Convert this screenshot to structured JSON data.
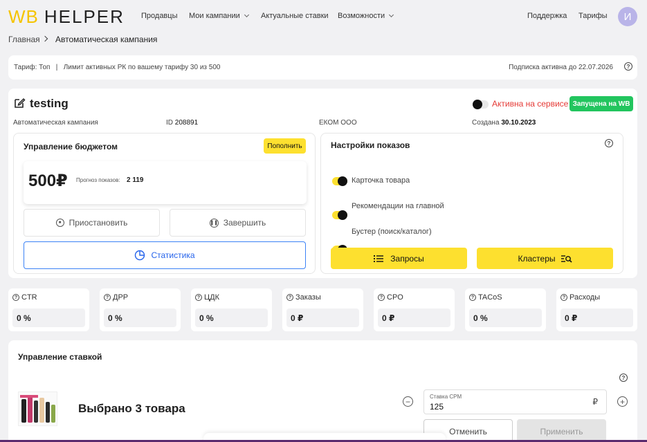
{
  "header": {
    "logo_wb": "WB",
    "logo_helper": "HELPER",
    "nav": [
      "Продавцы",
      "Мои кампании",
      "Актуальные ставки",
      "Возможности"
    ],
    "support": "Поддержка",
    "tariffs": "Тарифы",
    "avatar_letter": "И"
  },
  "breadcrumb": {
    "home": "Главная",
    "current": "Автоматическая кампания"
  },
  "tariff_bar": {
    "left": "Тариф: Топ   |   Лимит активных РК по вашему тарифу 30 из 500",
    "right": "Подписка активна до 22.07.2026"
  },
  "campaign": {
    "name": "testing",
    "active_label": "Активна на сервисе",
    "status_badge": "Запущена на WB",
    "type": "Автоматическая кампания",
    "id_label": "ID",
    "id_value": "208891",
    "company": "ЕКОМ ООО",
    "created_label": "Создана",
    "created_value": "30.10.2023"
  },
  "budget": {
    "title": "Управление бюджетом",
    "topup": "Пополнить",
    "amount": "500₽",
    "forecast_label": "Прогноз показов:",
    "forecast_value": "2 119",
    "pause": "Приостановить",
    "finish": "Завершить",
    "stats": "Статистика"
  },
  "display": {
    "title": "Настройки показов",
    "options": [
      "Карточка товара",
      "Рекомендации на главной",
      "Бустер (поиск/каталог)"
    ],
    "queries": "Запросы",
    "clusters": "Кластеры"
  },
  "metrics": [
    {
      "label": "CTR",
      "value": "0 %"
    },
    {
      "label": "ДРР",
      "value": "0 %"
    },
    {
      "label": "ЦДК",
      "value": "0 %"
    },
    {
      "label": "Заказы",
      "value": "0 ₽"
    },
    {
      "label": "CPO",
      "value": "0 ₽"
    },
    {
      "label": "TACoS",
      "value": "0 %"
    },
    {
      "label": "Расходы",
      "value": "0 ₽"
    }
  ],
  "bid": {
    "title": "Управление ставкой",
    "selected": "Выбрано 3 товара",
    "cpm_label": "Ставка CPM",
    "cpm_value": "125",
    "currency": "₽",
    "cancel": "Отменить",
    "apply": "Применить"
  },
  "colors": {
    "accent": "#fde02f",
    "green": "#22c55e",
    "red": "#e53935",
    "blue": "#3b82f6"
  }
}
